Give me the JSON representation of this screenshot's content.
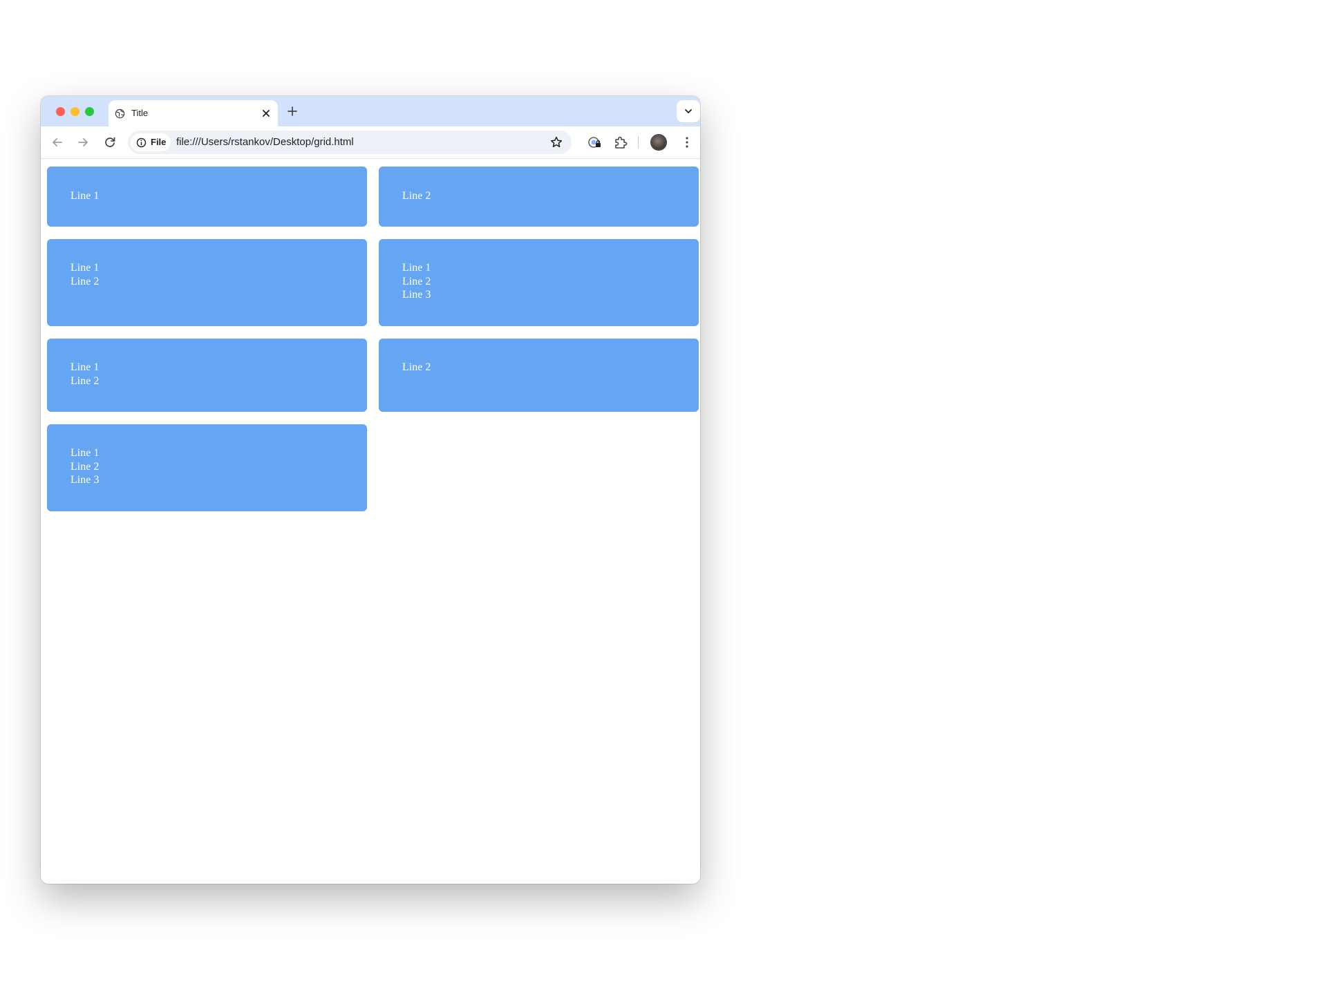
{
  "browser": {
    "tab": {
      "title": "Title"
    },
    "address_bar": {
      "chip_label": "File",
      "url": "file:///Users/rstankov/Desktop/grid.html"
    },
    "colors": {
      "tabstrip": "#d3e2fc",
      "close_traffic": "#fe5f57",
      "minimize_traffic": "#febc2e",
      "maximize_traffic": "#28c840"
    }
  },
  "page": {
    "cell_color": "#66a5f1",
    "cells": [
      {
        "lines": [
          "Line 1"
        ]
      },
      {
        "lines": [
          "Line 2"
        ]
      },
      {
        "lines": [
          "Line 1",
          "Line 2"
        ]
      },
      {
        "lines": [
          "Line 1",
          "Line 2",
          "Line 3"
        ]
      },
      {
        "lines": [
          "Line 1",
          "Line 2"
        ]
      },
      {
        "lines": [
          "Line 2"
        ]
      },
      {
        "lines": [
          "Line 1",
          "Line 2",
          "Line 3"
        ]
      }
    ]
  }
}
